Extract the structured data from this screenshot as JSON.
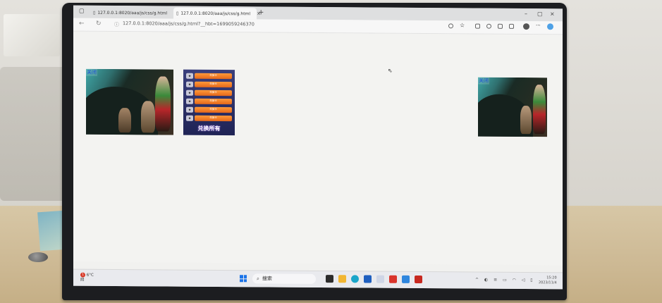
{
  "browser": {
    "tabs": [
      {
        "title": "127.0.0.1:8020/aaa/js/css/g.html",
        "active": false
      },
      {
        "title": "127.0.0.1:8020/aaa/js/css/g.html",
        "active": true
      }
    ],
    "new_tab": "+",
    "close_glyph": "×",
    "url": "127.0.0.1:8020/aaa/js/css/g.html?__hbt=1699059246370"
  },
  "page": {
    "left_banner_label": "关闭",
    "right_banner_label": "关闭",
    "ad_title": "兑换所有",
    "ad_rows": [
      "兑换卡",
      "兑换卡",
      "兑换卡",
      "兑换卡",
      "兑换卡",
      "兑换卡"
    ]
  },
  "taskbar": {
    "weather_badge": "1",
    "temperature": "6°C",
    "weather_text": "阴",
    "search_label": "搜索",
    "time": "15:20",
    "date": "2023/11/4"
  },
  "colors": {
    "page_bg": "#f3f3f1",
    "bezel": "#1c1d20",
    "accent": "#1a73e8",
    "ad_orange": "#e4671a"
  }
}
